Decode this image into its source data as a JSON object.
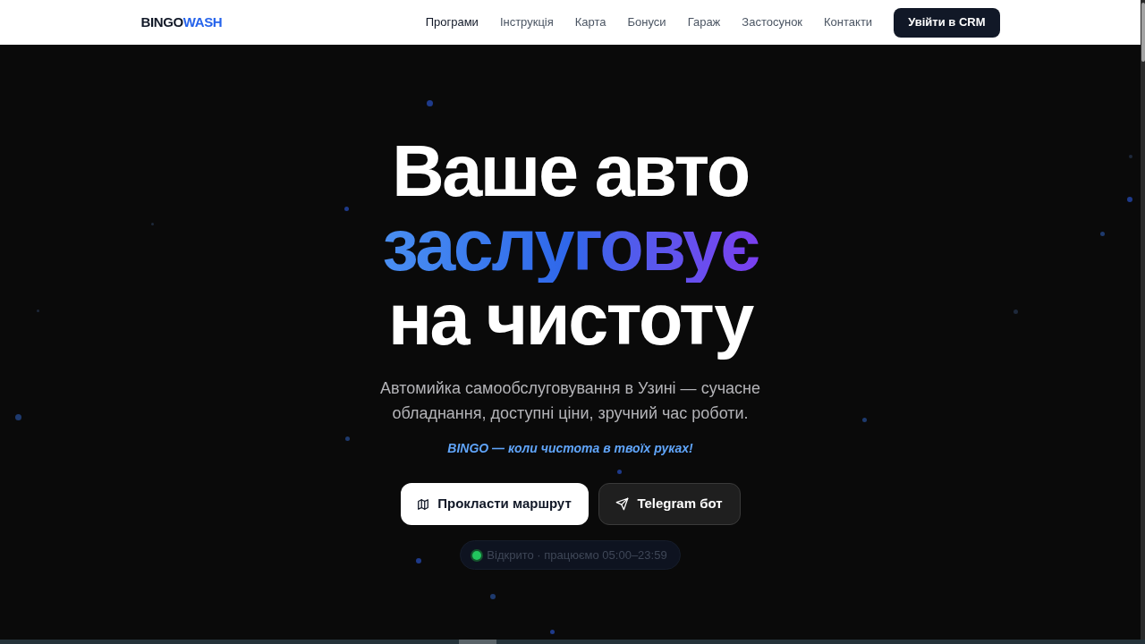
{
  "header": {
    "logo": {
      "primary": "BINGO",
      "accent": "WASH"
    },
    "nav": [
      {
        "label": "Програми",
        "selected": true
      },
      {
        "label": "Інструкція",
        "selected": false
      },
      {
        "label": "Карта",
        "selected": false
      },
      {
        "label": "Бонуси",
        "selected": false
      },
      {
        "label": "Гараж",
        "selected": false
      },
      {
        "label": "Застосунок",
        "selected": false
      },
      {
        "label": "Контакти",
        "selected": false
      }
    ],
    "cta_button": "Увійти в CRM"
  },
  "hero": {
    "title_lines": [
      {
        "text": "Ваше авто",
        "kind": "plain"
      },
      {
        "text": "заслуговує",
        "kind": "gradient"
      },
      {
        "text": "на чистоту",
        "kind": "plain"
      }
    ],
    "subtitle": "Автомийка самообслуговування в Узині — сучасне обладнання, доступні ціни, зручний час роботи.",
    "tagline": "BINGO — коли чистота в твоїх руках!",
    "buttons": [
      {
        "label": "Прокласти маршрут",
        "kind": "primary"
      },
      {
        "label": "Telegram бот",
        "kind": "secondary"
      }
    ],
    "status": {
      "text": "Відкрито · працюємо 05:00–23:59",
      "open": true
    }
  }
}
